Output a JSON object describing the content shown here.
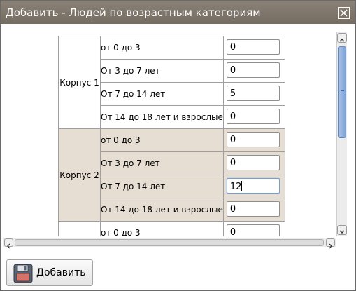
{
  "dialog": {
    "title": "Добавить - Людей по возрастным категориям",
    "close_icon": "close-x-icon"
  },
  "groups": [
    {
      "label": "Корпус 1",
      "rows": [
        {
          "category": "от 0 до 3",
          "value": "0"
        },
        {
          "category": "От 3 до 7 лет",
          "value": "0"
        },
        {
          "category": "От 7 до 14 лет",
          "value": "5"
        },
        {
          "category": "От 14 до 18 лет и взрослые",
          "value": "0"
        }
      ]
    },
    {
      "label": "Корпус 2",
      "rows": [
        {
          "category": "от 0 до 3",
          "value": "0"
        },
        {
          "category": "От 3 до 7 лет",
          "value": "0"
        },
        {
          "category": "От 7 до 14 лет",
          "value": "12"
        },
        {
          "category": "От 14 до 18 лет и взрослые",
          "value": "0"
        }
      ]
    },
    {
      "label": "",
      "rows": [
        {
          "category": "от 0 до 3",
          "value": "0"
        }
      ]
    }
  ],
  "footer": {
    "add_label": "Добавить",
    "add_icon": "floppy-disk-icon"
  },
  "colors": {
    "titlebar": "#7d746a",
    "group_shade": "#e6ded2",
    "scroll_thumb": "#8aaee0"
  }
}
